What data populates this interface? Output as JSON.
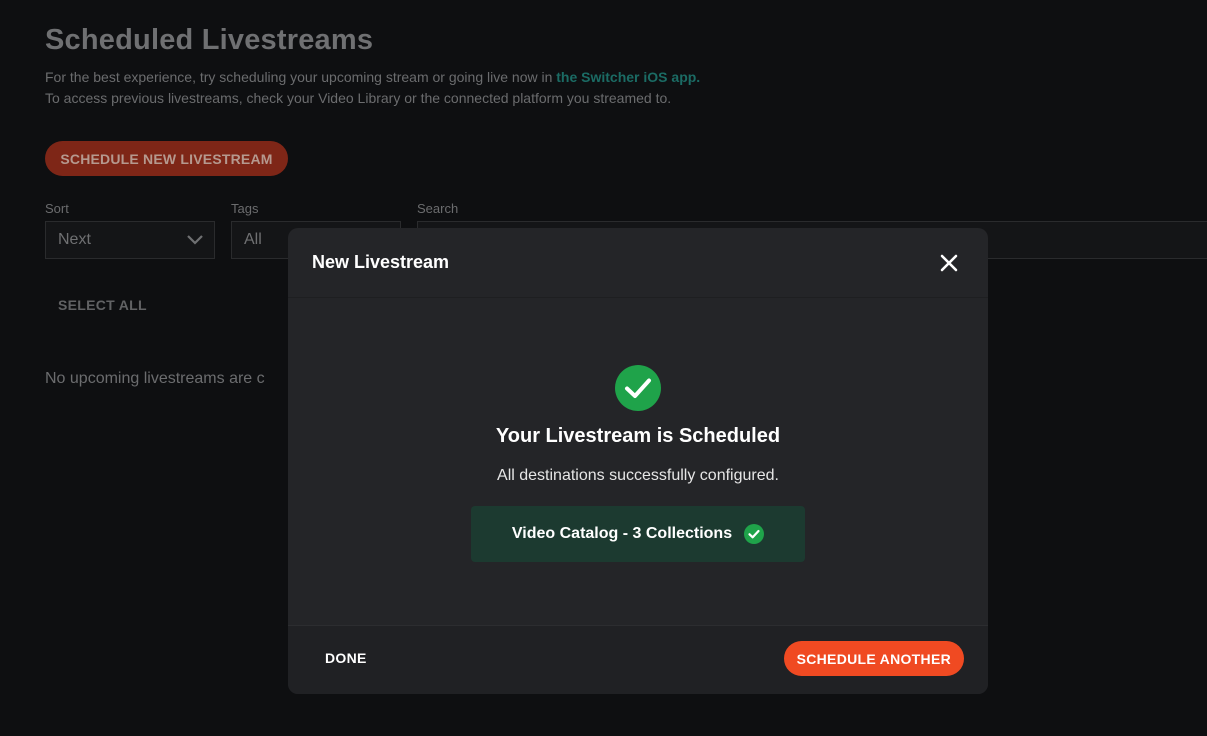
{
  "page": {
    "title": "Scheduled Livestreams",
    "intro_line1_prefix": "For the best experience, try scheduling your upcoming stream or going live now in ",
    "intro_link": "the Switcher iOS app.",
    "intro_line2": "To access previous livestreams, check your Video Library or the connected platform you streamed to.",
    "schedule_button": "SCHEDULE NEW LIVESTREAM",
    "sort": {
      "label": "Sort",
      "value": "Next"
    },
    "tags": {
      "label": "Tags",
      "value": "All"
    },
    "search": {
      "label": "Search"
    },
    "select_all": "SELECT ALL",
    "empty_message": "No upcoming livestreams are c"
  },
  "modal": {
    "title": "New Livestream",
    "success_title": "Your Livestream is Scheduled",
    "success_subtitle": "All destinations successfully configured.",
    "destination": "Video Catalog - 3 Collections",
    "done_button": "DONE",
    "schedule_another_button": "SCHEDULE ANOTHER"
  },
  "colors": {
    "accent": "#f04a22",
    "success": "#1fa34a",
    "link": "#1b6b64"
  }
}
